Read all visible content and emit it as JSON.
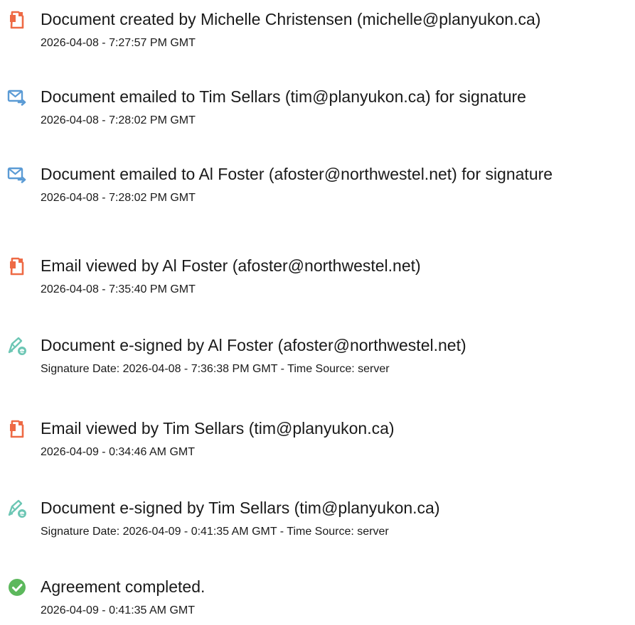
{
  "colors": {
    "document_icon": "#ee6a45",
    "email_icon": "#5b9bd5",
    "esign_icon": "#6cc6b4",
    "complete_icon": "#5cb85c",
    "text": "#1a1a1a"
  },
  "events": [
    {
      "icon": "document-icon",
      "title": "Document created by Michelle Christensen (michelle@planyukon.ca)",
      "time": "2026-04-08 - 7:27:57 PM GMT"
    },
    {
      "icon": "email-send-icon",
      "title": "Document emailed to Tim Sellars (tim@planyukon.ca) for signature",
      "time": "2026-04-08 - 7:28:02 PM GMT"
    },
    {
      "icon": "email-send-icon",
      "title": "Document emailed to Al Foster (afoster@northwestel.net) for signature",
      "time": "2026-04-08 - 7:28:02 PM GMT"
    },
    {
      "icon": "document-icon",
      "title": "Email viewed by Al Foster (afoster@northwestel.net)",
      "time": "2026-04-08 - 7:35:40 PM GMT"
    },
    {
      "icon": "esign-pen-icon",
      "title": "Document e-signed by Al Foster (afoster@northwestel.net)",
      "time": "Signature Date: 2026-04-08 - 7:36:38 PM GMT - Time Source: server"
    },
    {
      "icon": "document-icon",
      "title": "Email viewed by Tim Sellars (tim@planyukon.ca)",
      "time": "2026-04-09 - 0:34:46 AM GMT"
    },
    {
      "icon": "esign-pen-icon",
      "title": "Document e-signed by Tim Sellars (tim@planyukon.ca)",
      "time": "Signature Date: 2026-04-09 - 0:41:35 AM GMT - Time Source: server"
    },
    {
      "icon": "checkmark-circle-icon",
      "title": "Agreement completed.",
      "time": "2026-04-09 - 0:41:35 AM GMT"
    }
  ]
}
